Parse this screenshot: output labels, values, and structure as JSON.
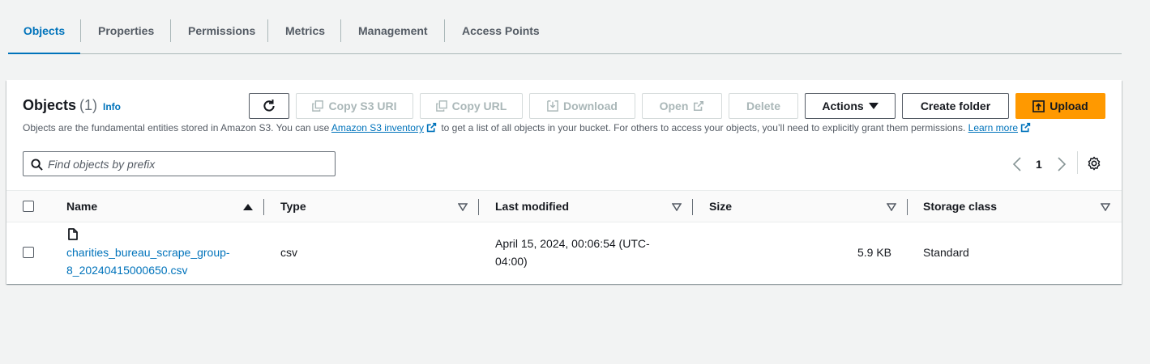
{
  "tabs": [
    {
      "label": "Objects",
      "active": true
    },
    {
      "label": "Properties"
    },
    {
      "label": "Permissions"
    },
    {
      "label": "Metrics"
    },
    {
      "label": "Management"
    },
    {
      "label": "Access Points"
    }
  ],
  "objects_panel": {
    "title": "Objects",
    "count": "(1)",
    "info": "Info",
    "description_part1": "Objects are the fundamental entities stored in Amazon S3. You can use",
    "inventory_link": "Amazon S3 inventory",
    "description_part2": "to get a list of all objects in your bucket. For others to access your objects, you’ll need to explicitly grant them permissions.",
    "learn_more": "Learn more"
  },
  "toolbar": {
    "refresh_icon": "refresh-icon",
    "copy_s3_uri": "Copy S3 URI",
    "copy_url": "Copy URL",
    "download": "Download",
    "open": "Open",
    "delete": "Delete",
    "actions": "Actions",
    "create_folder": "Create folder",
    "upload": "Upload"
  },
  "search": {
    "placeholder": "Find objects by prefix",
    "value": ""
  },
  "pagination": {
    "current_page": "1"
  },
  "table": {
    "columns": [
      "Name",
      "Type",
      "Last modified",
      "Size",
      "Storage class"
    ],
    "rows": [
      {
        "name_line1": "charities_bureau_scrape_group-",
        "name_line2": "8_20240415000650.csv",
        "type": "csv",
        "last_modified_line1": "April 15, 2024, 00:06:54 (UTC-",
        "last_modified_line2": "04:00)",
        "size": "5.9 KB",
        "storage_class": "Standard"
      }
    ]
  },
  "colors": {
    "accent": "#0073bb",
    "primary_button": "#ff9900",
    "background": "#f2f3f3"
  }
}
